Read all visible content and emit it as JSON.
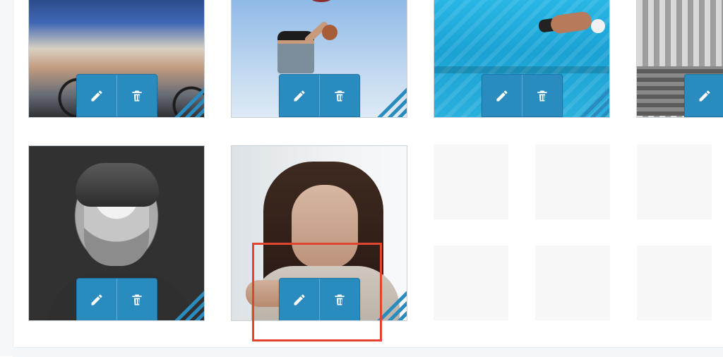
{
  "gallery": {
    "tiles": [
      {
        "name": "cycling-photo",
        "has_actions": true
      },
      {
        "name": "basketball-photo",
        "has_actions": true
      },
      {
        "name": "swimmer-photo",
        "has_actions": true
      },
      {
        "name": "track-photo",
        "has_actions": true
      },
      {
        "name": "man-portrait-photo",
        "has_actions": true
      },
      {
        "name": "woman-portrait-photo",
        "has_actions": true
      }
    ],
    "empty_placeholders": 6
  },
  "icons": {
    "edit": "pencil-icon",
    "delete": "trash-icon"
  },
  "colors": {
    "accent": "#2a8bbf",
    "accent_border": "#1e74a7",
    "highlight": "#e2452f",
    "tile_border": "#c9d0d6"
  }
}
